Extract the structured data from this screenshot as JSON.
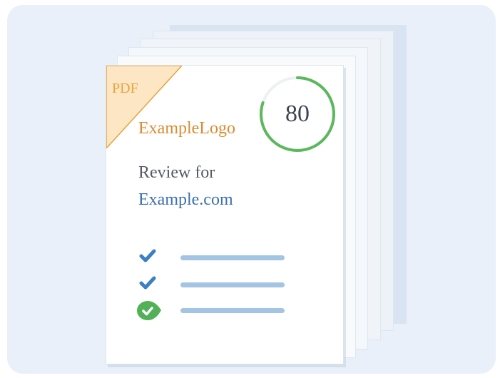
{
  "document_card": {
    "badge": {
      "label": "PDF",
      "color": "#e8a33c",
      "fill": "#fde6c4"
    },
    "logo_text": "ExampleLogo",
    "review_prefix": "Review for",
    "site": "Example.com",
    "score": {
      "value": "80",
      "fraction": 0.8,
      "ring_color": "#5cb85c",
      "track_color": "#eef1f4"
    }
  },
  "checklist": [
    {
      "icon": "checkmark-icon",
      "color": "#3b7fc4"
    },
    {
      "icon": "checkmark-icon",
      "color": "#3b7fc4"
    },
    {
      "icon": "check-badge-icon",
      "color": "#52b157"
    }
  ],
  "colors": {
    "panel_background": "#e9f0f9",
    "placeholder_bar": "#a3c4e3"
  }
}
